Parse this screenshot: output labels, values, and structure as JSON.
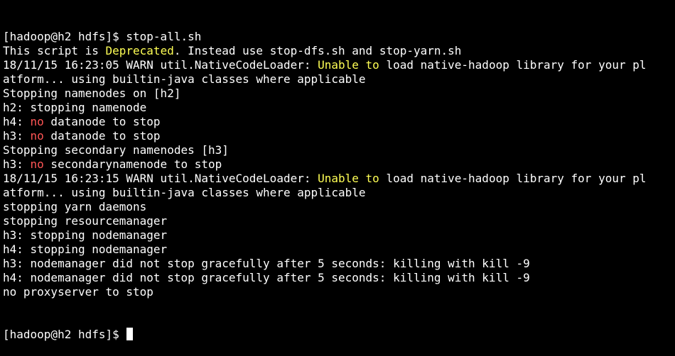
{
  "terminal": {
    "lines": [
      {
        "segments": [
          {
            "text": "[hadoop@h2 hdfs]$ stop-all.sh"
          }
        ]
      },
      {
        "segments": [
          {
            "text": "This script is "
          },
          {
            "text": "Deprecated",
            "color": "yellow"
          },
          {
            "text": ". Instead use stop-dfs.sh and stop-yarn.sh"
          }
        ]
      },
      {
        "segments": [
          {
            "text": "18/11/15 16:23:05 WARN util.NativeCodeLoader: "
          },
          {
            "text": "Unable to",
            "color": "yellow"
          },
          {
            "text": " load native-hadoop library for your pl"
          }
        ]
      },
      {
        "segments": [
          {
            "text": "atform... using builtin-java classes where applicable"
          }
        ]
      },
      {
        "segments": [
          {
            "text": "Stopping namenodes on [h2]"
          }
        ]
      },
      {
        "segments": [
          {
            "text": "h2: stopping namenode"
          }
        ]
      },
      {
        "segments": [
          {
            "text": "h4: "
          },
          {
            "text": "no",
            "color": "red"
          },
          {
            "text": " datanode to stop"
          }
        ]
      },
      {
        "segments": [
          {
            "text": "h3: "
          },
          {
            "text": "no",
            "color": "red"
          },
          {
            "text": " datanode to stop"
          }
        ]
      },
      {
        "segments": [
          {
            "text": "Stopping secondary namenodes [h3]"
          }
        ]
      },
      {
        "segments": [
          {
            "text": "h3: "
          },
          {
            "text": "no",
            "color": "red"
          },
          {
            "text": " secondarynamenode to stop"
          }
        ]
      },
      {
        "segments": [
          {
            "text": "18/11/15 16:23:15 WARN util.NativeCodeLoader: "
          },
          {
            "text": "Unable to",
            "color": "yellow"
          },
          {
            "text": " load native-hadoop library for your pl"
          }
        ]
      },
      {
        "segments": [
          {
            "text": "atform... using builtin-java classes where applicable"
          }
        ]
      },
      {
        "segments": [
          {
            "text": "stopping yarn daemons"
          }
        ]
      },
      {
        "segments": [
          {
            "text": "stopping resourcemanager"
          }
        ]
      },
      {
        "segments": [
          {
            "text": "h3: stopping nodemanager"
          }
        ]
      },
      {
        "segments": [
          {
            "text": "h4: stopping nodemanager"
          }
        ]
      },
      {
        "segments": [
          {
            "text": "h3: nodemanager did not stop gracefully after 5 seconds: killing with kill -9"
          }
        ]
      },
      {
        "segments": [
          {
            "text": "h4: nodemanager did not stop gracefully after 5 seconds: killing with kill -9"
          }
        ]
      },
      {
        "segments": [
          {
            "text": "no proxyserver to stop"
          }
        ]
      }
    ],
    "prompt": "[hadoop@h2 hdfs]$ ",
    "colors": {
      "background": "#000000",
      "text": "#ffffff",
      "yellow": "#ffff55",
      "red": "#ff5555"
    }
  }
}
